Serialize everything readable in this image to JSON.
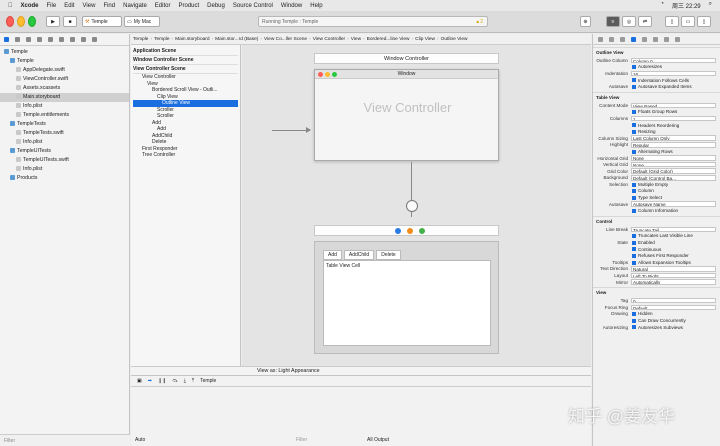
{
  "menubar": {
    "apple": "",
    "app": "Xcode",
    "items": [
      "File",
      "Edit",
      "View",
      "Find",
      "Navigate",
      "Editor",
      "Product",
      "Debug",
      "Source Control",
      "Window",
      "Help"
    ],
    "clock": "周三 22:29"
  },
  "toolbar": {
    "scheme": "Temple",
    "destination": "My Mac",
    "status": "Running Temple : Temple",
    "warning_count": "2"
  },
  "navigator": {
    "items": [
      {
        "label": "Temple",
        "level": 0
      },
      {
        "label": "Temple",
        "level": 1
      },
      {
        "label": "AppDelegate.swift",
        "level": 2
      },
      {
        "label": "ViewController.swift",
        "level": 2
      },
      {
        "label": "Assets.xcassets",
        "level": 2
      },
      {
        "label": "Main.storyboard",
        "level": 2
      },
      {
        "label": "Info.plist",
        "level": 2
      },
      {
        "label": "Temple.entitlements",
        "level": 2
      },
      {
        "label": "TempleTests",
        "level": 1
      },
      {
        "label": "TempleTests.swift",
        "level": 2
      },
      {
        "label": "Info.plist",
        "level": 2
      },
      {
        "label": "TempleUITests",
        "level": 1
      },
      {
        "label": "TempleUITests.swift",
        "level": 2
      },
      {
        "label": "Info.plist",
        "level": 2
      },
      {
        "label": "Products",
        "level": 1
      }
    ],
    "filter_placeholder": "Filter"
  },
  "jumpbar": [
    "Temple",
    "Temple",
    "Main.storyboard",
    "Main.stor...rd (Base)",
    "View Co...ller Scene",
    "View Controller",
    "View",
    "Bordered...line View",
    "Clip View",
    "Outline View"
  ],
  "outline": {
    "sections": [
      {
        "title": "Application Scene",
        "rows": []
      },
      {
        "title": "Window Controller Scene",
        "rows": []
      },
      {
        "title": "View Controller Scene",
        "rows": [
          {
            "label": "View Controller",
            "level": 1,
            "selected": false
          },
          {
            "label": "View",
            "level": 2,
            "selected": false
          },
          {
            "label": "Bordered Scroll View - Outli...",
            "level": 3,
            "selected": false
          },
          {
            "label": "Clip View",
            "level": 4,
            "selected": false
          },
          {
            "label": "Outline View",
            "level": 5,
            "selected": true
          },
          {
            "label": "Scroller",
            "level": 4,
            "selected": false
          },
          {
            "label": "Scroller",
            "level": 4,
            "selected": false
          },
          {
            "label": "Add",
            "level": 3,
            "selected": false
          },
          {
            "label": "Add",
            "level": 4,
            "selected": false
          },
          {
            "label": "AddChild",
            "level": 3,
            "selected": false
          },
          {
            "label": "Delete",
            "level": 3,
            "selected": false
          },
          {
            "label": "First Responder",
            "level": 1,
            "selected": false
          },
          {
            "label": "Tree Controller",
            "level": 1,
            "selected": false
          }
        ]
      }
    ],
    "filter_placeholder": "Filter"
  },
  "canvas": {
    "scene_title": "Window Controller",
    "window_title": "Window",
    "vc_label": "View Controller",
    "outline_tabs": [
      "Add",
      "AddChild",
      "Delete"
    ],
    "table_cell": "Table View Cell",
    "view_as": "View as: Light Appearance"
  },
  "debug": {
    "target": "Temple",
    "auto_label": "Auto",
    "all_output": "All Output",
    "filter": "Filter"
  },
  "inspector": {
    "outline_view": [
      [
        "Outline Column",
        "Column 0",
        "popup"
      ],
      [
        "",
        "Autoresizes",
        "check"
      ],
      [
        "Indentation",
        "16",
        "field"
      ],
      [
        "",
        "Indentation Follows Cells",
        "check"
      ],
      [
        "Autosave",
        "Autosave Expanded Items",
        "check"
      ]
    ],
    "table_view": [
      [
        "Content Mode",
        "View Based",
        "popup"
      ],
      [
        "",
        "Floats Group Rows",
        "check"
      ],
      [
        "Columns",
        "1",
        "field"
      ],
      [
        "",
        "Headers   Reordering",
        "check"
      ],
      [
        "",
        "Resizing",
        "check"
      ],
      [
        "Column Sizing",
        "Last Column Only",
        "popup"
      ],
      [
        "Highlight",
        "Regular",
        "popup"
      ],
      [
        "",
        "Alternating Rows",
        "check"
      ],
      [
        "Horizontal Grid",
        "None",
        "popup"
      ],
      [
        "Vertical Grid",
        "None",
        "popup"
      ],
      [
        "Grid Color",
        "Default (Grid Color)",
        "popup"
      ],
      [
        "Background",
        "Default (Control Ba...",
        "popup"
      ],
      [
        "Selection",
        "Multiple   Empty",
        "check"
      ],
      [
        "",
        "Column",
        "check"
      ],
      [
        "",
        "Type Select",
        "check"
      ],
      [
        "Autosave",
        "Autosave Name",
        "field"
      ],
      [
        "",
        "Column Information",
        "check"
      ]
    ],
    "control": [
      [
        "Line Break",
        "Truncate Tail",
        "popup"
      ],
      [
        "",
        "Truncates Last Visible Line",
        "check"
      ],
      [
        "State",
        "Enabled",
        "check"
      ],
      [
        "",
        "Continuous",
        "check"
      ],
      [
        "",
        "Refuses First Responder",
        "check"
      ],
      [
        "Tooltips",
        "Allows Expansion Tooltips",
        "check"
      ],
      [
        "Text Direction",
        "Natural",
        "popup"
      ],
      [
        "Layout",
        "Left To Right",
        "popup"
      ],
      [
        "Mirror",
        "Automatically",
        "popup"
      ]
    ],
    "view": [
      [
        "Tag",
        "0",
        "field"
      ],
      [
        "Focus Ring",
        "Default",
        "popup"
      ],
      [
        "Drawing",
        "Hidden",
        "check"
      ],
      [
        "",
        "Can Draw Concurrently",
        "check"
      ],
      [
        "Autoresizing",
        "Autoresizes Subviews",
        "check"
      ]
    ],
    "section_titles": {
      "outline": "Outline View",
      "table": "Table View",
      "control": "Control",
      "view": "View"
    }
  },
  "watermark": "知乎 @姜友华"
}
